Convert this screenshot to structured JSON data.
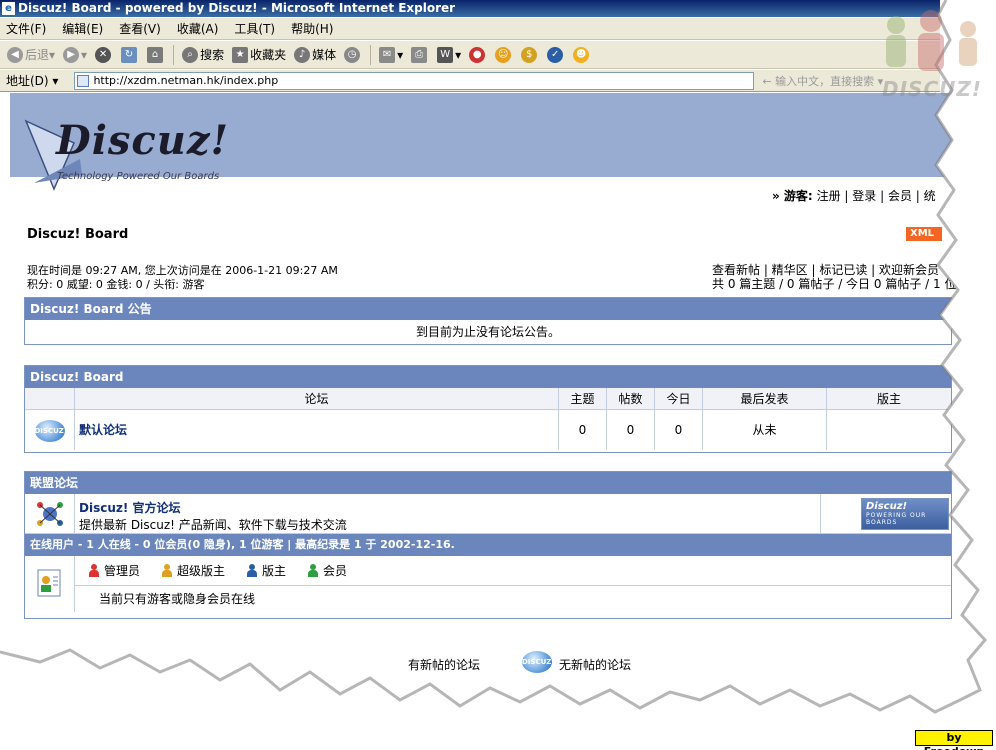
{
  "window": {
    "title": "Discuz! Board - powered by Discuz! - Microsoft Internet Explorer"
  },
  "menu": [
    "文件(F)",
    "编辑(E)",
    "查看(V)",
    "收藏(A)",
    "工具(T)",
    "帮助(H)"
  ],
  "toolbar": {
    "back": "后退",
    "search": "搜索",
    "favorites": "收藏夹",
    "media": "媒体"
  },
  "address": {
    "label": "地址(D)",
    "url": "http://xzdm.netman.hk/index.php",
    "search_hint": "输入中文，直接搜索"
  },
  "logo": {
    "word": "Discuz!",
    "tagline": "Technology Powered Our Boards"
  },
  "userbar": {
    "guest": "» 游客:",
    "register": "注册",
    "login": "登录",
    "members": "会员",
    "stats": "统"
  },
  "board": {
    "name": "Discuz! Board",
    "xml": "XML"
  },
  "status": {
    "time_line": "现在时间是  09:27 AM, 您上次访问是在  2006-1-21 09:27 AM",
    "points_line": "积分: 0  威望: 0  金钱: 0  / 头衔: 游客",
    "quick_links": "查看新帖 | 精华区 | 标记已读 | 欢迎新会员",
    "totals": "共 0 篇主题 / 0 篇帖子 / 今日 0 篇帖子 / 1 位"
  },
  "announcement": {
    "header": "Discuz! Board 公告",
    "body": "到目前为止没有论坛公告。"
  },
  "forums": {
    "header": "Discuz! Board",
    "columns": [
      "论坛",
      "主题",
      "帖数",
      "今日",
      "最后发表",
      "版主"
    ],
    "rows": [
      {
        "name": "默认论坛",
        "topics": "0",
        "posts": "0",
        "today": "0",
        "last_post": "从未",
        "moderator": ""
      }
    ]
  },
  "league": {
    "header": "联盟论坛",
    "title": "Discuz! 官方论坛",
    "desc": "提供最新 Discuz! 产品新闻、软件下载与技术交流",
    "banner_word": "Discuz!",
    "banner_tag": "POWERING OUR BOARDS"
  },
  "online": {
    "header": "在线用户  -  1 人在线  - 0 位会员(0 隐身), 1 位游客 | 最高纪录是  1  于  2002-12-16.",
    "legend": [
      "管理员",
      "超级版主",
      "版主",
      "会员"
    ],
    "note": "当前只有游客或隐身会员在线"
  },
  "footer": {
    "new_posts": "有新帖的论坛",
    "no_new_posts": "无新帖的论坛"
  },
  "bubble_text": "DISCUZ!",
  "watermark": "DISCUZ!",
  "byline": "by Freedown",
  "colors": {
    "header_band": "#98acd2",
    "panel_head": "#6b86bc",
    "xml_badge": "#f26522",
    "admin": "#d33",
    "super_mod": "#e0a020",
    "mod": "#2a5ea6",
    "member": "#2e9e3e"
  }
}
